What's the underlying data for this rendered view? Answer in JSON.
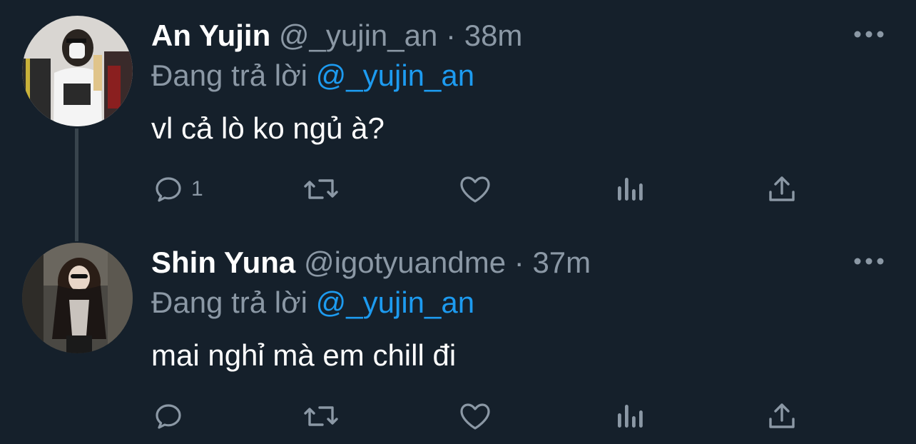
{
  "tweets": [
    {
      "display_name": "An Yujin",
      "handle": "@_yujin_an",
      "separator": "·",
      "time": "38m",
      "reply_prefix": "Đang trả lời",
      "reply_to": "@_yujin_an",
      "text": "vl cả lò ko ngủ à?",
      "reply_count": "1",
      "avatar": "avatar-mirror-selfie"
    },
    {
      "display_name": "Shin Yuna",
      "handle": "@igotyuandme",
      "separator": "·",
      "time": "37m",
      "reply_prefix": "Đang trả lời",
      "reply_to": "@_yujin_an",
      "text": "mai nghỉ mà em chill đi",
      "reply_count": "",
      "avatar": "avatar-night-street"
    }
  ],
  "icons": {
    "reply": "reply-icon",
    "retweet": "retweet-icon",
    "like": "like-icon",
    "views": "views-icon",
    "share": "share-icon",
    "more": "more-icon"
  },
  "colors": {
    "background": "#15202b",
    "secondary_text": "#8b98a5",
    "mention": "#1d9bf0",
    "thread_line": "#38444d"
  }
}
